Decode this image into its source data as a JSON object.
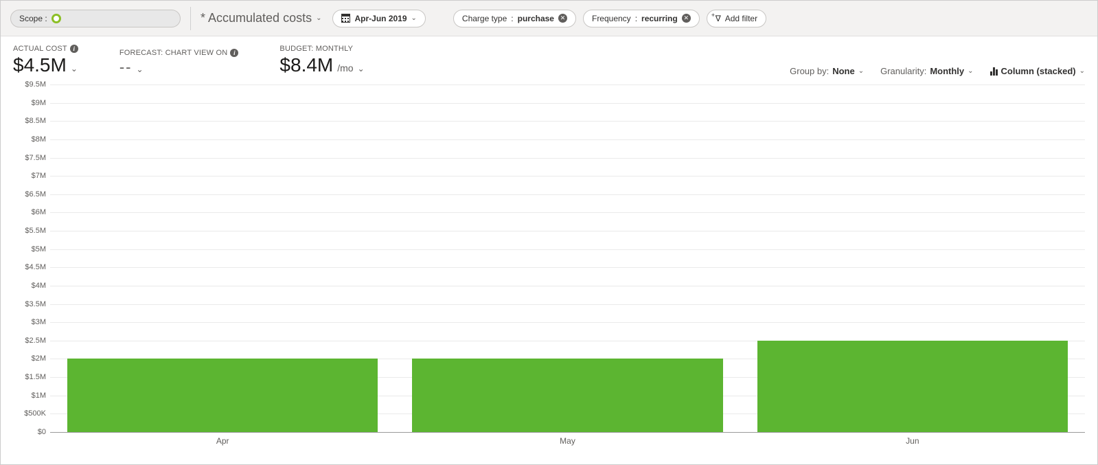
{
  "toolbar": {
    "scope_label": "Scope :",
    "view_name": "* Accumulated costs",
    "date_range": "Apr-Jun 2019",
    "filters": [
      {
        "key": "Charge type",
        "value": "purchase"
      },
      {
        "key": "Frequency",
        "value": "recurring"
      }
    ],
    "add_filter_label": "Add filter"
  },
  "kpis": {
    "actual": {
      "label": "ACTUAL COST",
      "value": "$4.5M"
    },
    "forecast": {
      "label": "FORECAST: CHART VIEW ON",
      "value": "--"
    },
    "budget": {
      "label": "BUDGET: MONTHLY",
      "value": "$8.4M",
      "suffix": "/mo"
    }
  },
  "controls": {
    "group_by_label": "Group by:",
    "group_by_value": "None",
    "granularity_label": "Granularity:",
    "granularity_value": "Monthly",
    "chart_type": "Column (stacked)"
  },
  "chart_data": {
    "type": "bar",
    "title": "",
    "xlabel": "",
    "ylabel": "",
    "categories": [
      "Apr",
      "May",
      "Jun"
    ],
    "values": [
      2000000,
      2000000,
      2500000
    ],
    "ylim": [
      0,
      9500000
    ],
    "y_ticks": [
      0,
      500000,
      1000000,
      1500000,
      2000000,
      2500000,
      3000000,
      3500000,
      4000000,
      4500000,
      5000000,
      5500000,
      6000000,
      6500000,
      7000000,
      7500000,
      8000000,
      8500000,
      9000000,
      9500000
    ],
    "y_tick_labels": [
      "$0",
      "$500K",
      "$1M",
      "$1.5M",
      "$2M",
      "$2.5M",
      "$3M",
      "$3.5M",
      "$4M",
      "$4.5M",
      "$5M",
      "$5.5M",
      "$6M",
      "$6.5M",
      "$7M",
      "$7.5M",
      "$8M",
      "$8.5M",
      "$9M",
      "$9.5M"
    ],
    "bar_color": "#5cb531"
  }
}
